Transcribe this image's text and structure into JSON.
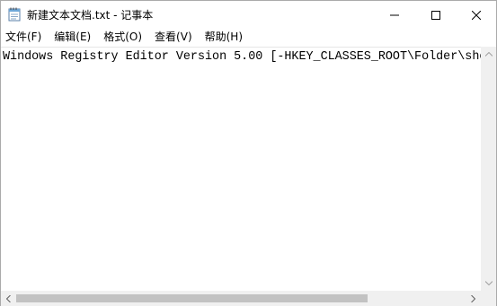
{
  "window": {
    "title": "新建文本文档.txt - 记事本"
  },
  "menu": {
    "items": [
      {
        "label": "文件(F)"
      },
      {
        "label": "编辑(E)"
      },
      {
        "label": "格式(O)"
      },
      {
        "label": "查看(V)"
      },
      {
        "label": "帮助(H)"
      }
    ]
  },
  "editor": {
    "content": "Windows Registry Editor Version 5.00 [-HKEY_CLASSES_ROOT\\Folder\\she"
  },
  "icons": {
    "app": "notepad-icon",
    "minimize": "minimize-icon",
    "maximize": "maximize-icon",
    "close": "close-icon"
  },
  "colors": {
    "background": "#ffffff",
    "scrollbar": "#f0f0f0",
    "thumb": "#c2c2c2"
  }
}
